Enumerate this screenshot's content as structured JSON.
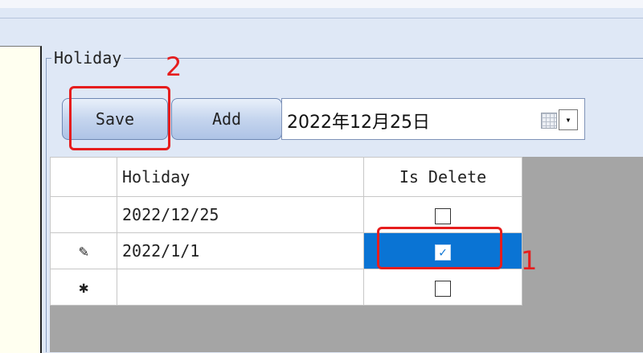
{
  "group": {
    "title": "Holiday"
  },
  "toolbar": {
    "save_label": "Save",
    "add_label": "Add",
    "date_value": "2022年12月25日",
    "calendar_icon": "calendar-icon",
    "dropdown_glyph": "▾"
  },
  "grid": {
    "columns": [
      "Holiday",
      "Is Delete"
    ],
    "rows": [
      {
        "header_glyph": "",
        "holiday": "2022/12/25",
        "is_delete": false
      },
      {
        "header_glyph": "✎",
        "holiday": "2022/1/1",
        "is_delete": true,
        "selected_cell": "is_delete"
      },
      {
        "header_glyph": "✱",
        "holiday": "",
        "is_delete": false
      }
    ]
  },
  "annotations": {
    "step1_label": "1",
    "step2_label": "2",
    "color": "#e61d1d"
  },
  "colors": {
    "selection": "#0a74d4",
    "background": "#dfe8f6",
    "grid_empty": "#a5a5a5"
  }
}
